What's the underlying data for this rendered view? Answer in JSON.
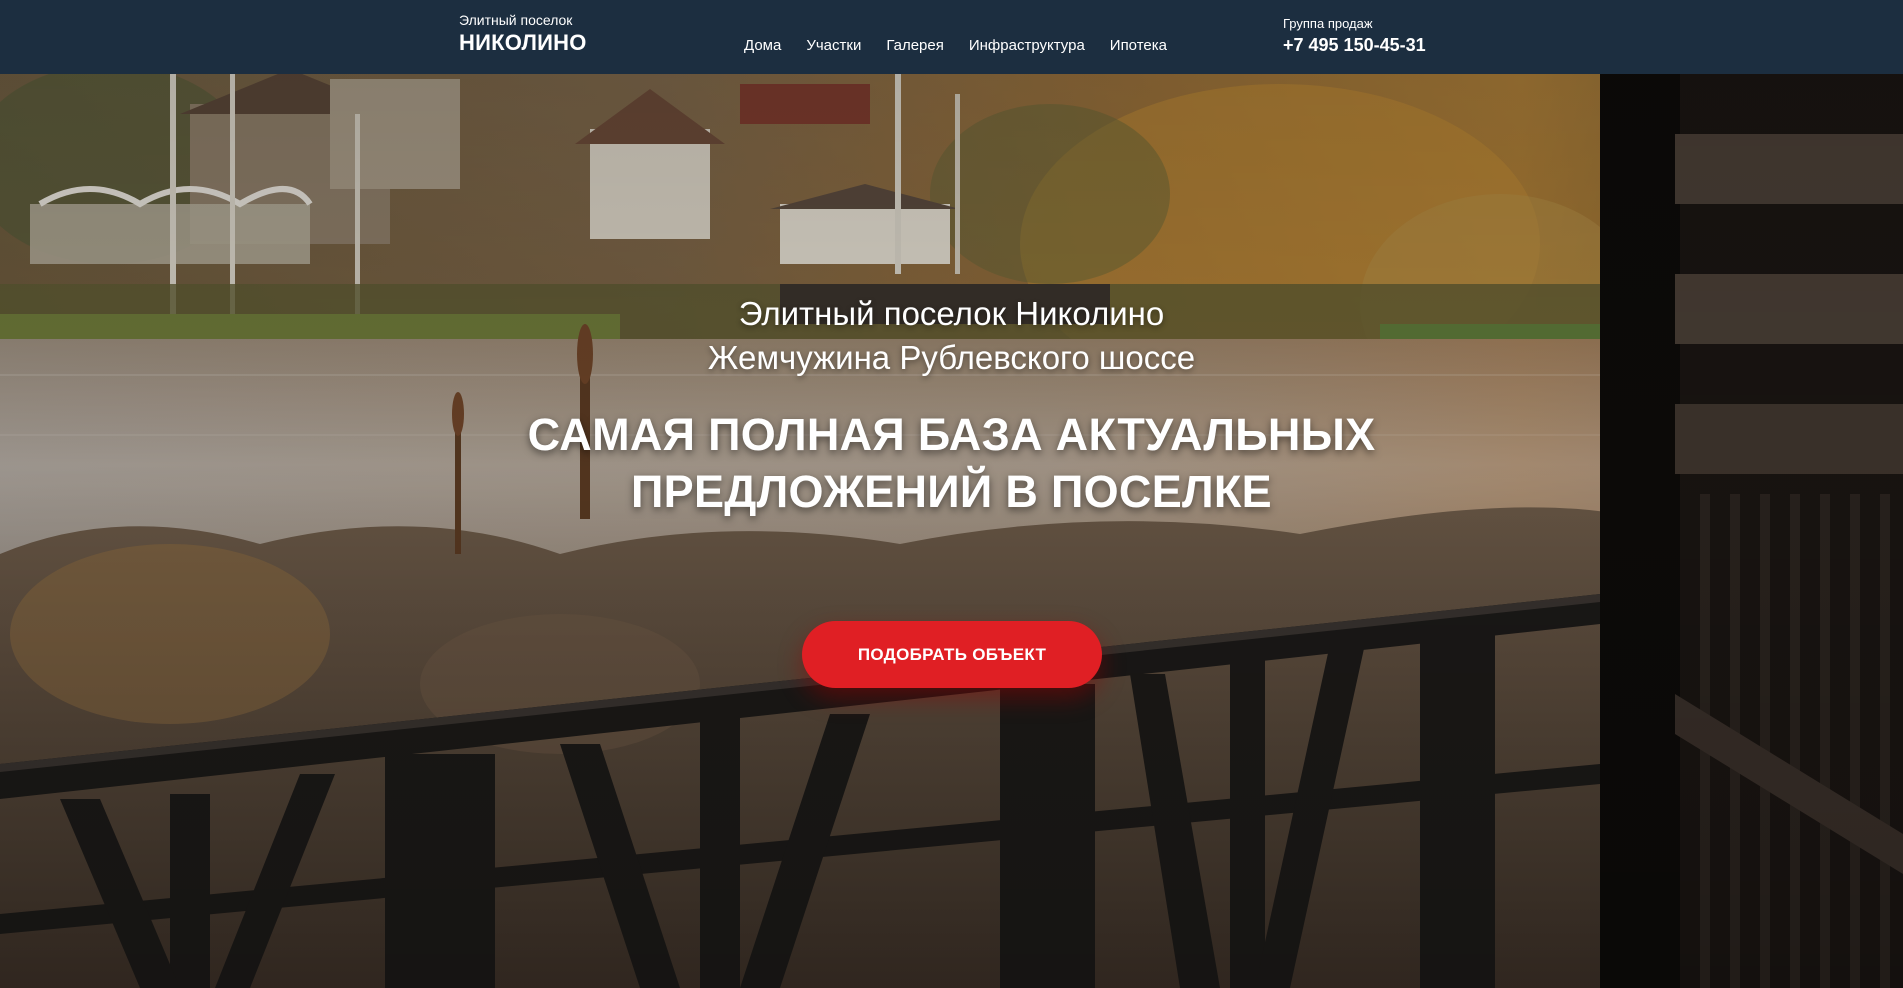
{
  "header": {
    "logo_sub": "Элитный поселок",
    "logo_main": "НИКОЛИНО",
    "nav": [
      "Дома",
      "Участки",
      "Галерея",
      "Инфраструктура",
      "Ипотека"
    ],
    "contact_label": "Группа продаж",
    "contact_phone": "+7 495 150-45-31"
  },
  "hero": {
    "subtitle_line1": "Элитный поселок Николино",
    "subtitle_line2": "Жемчужина Рублевского шоссе",
    "title_line1": "САМАЯ ПОЛНАЯ БАЗА АКТУАЛЬНЫХ",
    "title_line2": "ПРЕДЛОЖЕНИЙ В ПОСЕЛКЕ",
    "cta_label": "ПОДОБРАТЬ ОБЪЕКТ"
  },
  "colors": {
    "header_bg": "#1c2e40",
    "accent": "#e01f24",
    "text": "#ffffff"
  }
}
